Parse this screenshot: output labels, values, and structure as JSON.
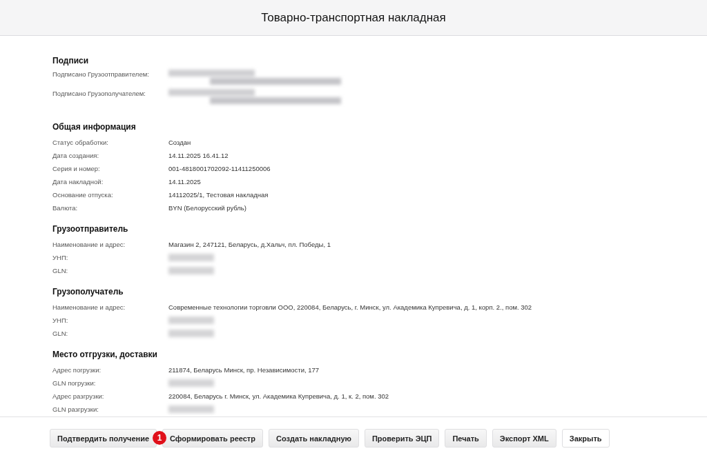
{
  "header": {
    "title": "Товарно-транспортная накладная"
  },
  "sections": [
    {
      "title": "Подписи",
      "rows": [
        {
          "label": "Подписано Грузоотправителем:",
          "kind": "redacted_block"
        },
        {
          "label": "Подписано Грузополучателем:",
          "kind": "redacted_block"
        }
      ]
    },
    {
      "title": "Общая информация",
      "rows": [
        {
          "label": "Статус обработки:",
          "kind": "text",
          "value": "Создан"
        },
        {
          "label": "Дата создания:",
          "kind": "text",
          "value": "14.11.2025 16.41.12"
        },
        {
          "label": "Серия и номер:",
          "kind": "text",
          "value": "001-4818001702092-11411250006"
        },
        {
          "label": "Дата накладной:",
          "kind": "text",
          "value": "14.11.2025"
        },
        {
          "label": "Основание отпуска:",
          "kind": "text",
          "value": "14112025/1, Тестовая накладная"
        },
        {
          "label": "Валюта:",
          "kind": "text",
          "value": "BYN (Белорусский рубль)"
        }
      ]
    },
    {
      "title": "Грузоотправитель",
      "rows": [
        {
          "label": "Наименование и адрес:",
          "kind": "text",
          "value": "Магазин 2, 247121, Беларусь, д.Хальч, пл. Победы, 1"
        },
        {
          "label": "УНП:",
          "kind": "redacted"
        },
        {
          "label": "GLN:",
          "kind": "redacted"
        }
      ]
    },
    {
      "title": "Грузополучатель",
      "rows": [
        {
          "label": "Наименование и адрес:",
          "kind": "text",
          "value": "Современные технологии торговли ООО, 220084, Беларусь, г. Минск, ул. Академика Купревича, д. 1, корп. 2., пом. 302"
        },
        {
          "label": "УНП:",
          "kind": "redacted"
        },
        {
          "label": "GLN:",
          "kind": "redacted"
        }
      ]
    },
    {
      "title": "Место отгрузки, доставки",
      "rows": [
        {
          "label": "Адрес погрузки:",
          "kind": "text",
          "value": "211874, Беларусь Минск, пр. Независимости, 177"
        },
        {
          "label": "GLN погрузки:",
          "kind": "redacted"
        },
        {
          "label": "Адрес разгрузки:",
          "kind": "text",
          "value": "220084, Беларусь г. Минск, ул. Академика Купревича, д. 1, к. 2, пом. 302"
        },
        {
          "label": "GLN разгрузки:",
          "kind": "redacted"
        }
      ]
    }
  ],
  "buttons": [
    {
      "label": "Подтвердить получение",
      "kind": "shaded"
    },
    {
      "label": "Сформировать реестр",
      "kind": "shaded",
      "marker": "1"
    },
    {
      "label": "Создать накладную",
      "kind": "shaded"
    },
    {
      "label": "Проверить ЭЦП",
      "kind": "shaded"
    },
    {
      "label": "Печать",
      "kind": "shaded"
    },
    {
      "label": "Экспорт XML",
      "kind": "shaded"
    },
    {
      "label": "Закрыть",
      "kind": "plain"
    }
  ]
}
